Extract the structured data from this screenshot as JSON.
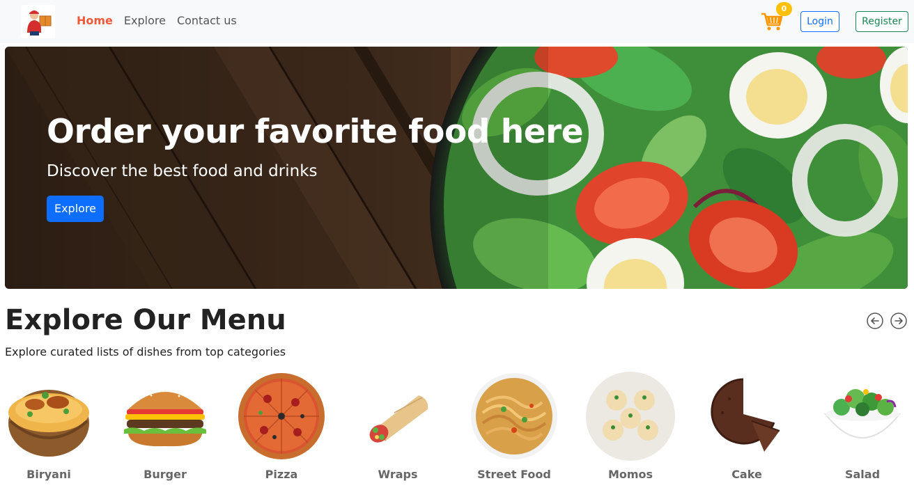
{
  "nav": {
    "links": [
      "Home",
      "Explore",
      "Contact us"
    ],
    "cart_count": "0",
    "login_label": "Login",
    "register_label": "Register"
  },
  "hero": {
    "title": "Order your favorite food here",
    "subtitle": "Discover the best food and drinks",
    "button_label": "Explore"
  },
  "menu": {
    "heading": "Explore Our Menu",
    "subtitle": "Explore curated lists of dishes from top categories",
    "categories": [
      "Biryani",
      "Burger",
      "Pizza",
      "Wraps",
      "Street Food",
      "Momos",
      "Cake",
      "Salad"
    ]
  },
  "colors": {
    "active_link": "#f05a3a",
    "primary": "#0d6efd",
    "success": "#198754",
    "badge": "#ffc107",
    "cart": "#ff9800"
  },
  "icons": [
    "delivery-logo-icon",
    "cart-icon",
    "arrow-left-circle-icon",
    "arrow-right-circle-icon"
  ]
}
